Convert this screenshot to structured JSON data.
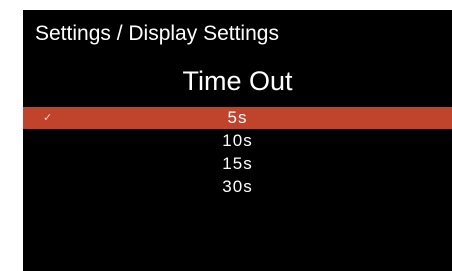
{
  "header": {
    "breadcrumb": "Settings / Display Settings"
  },
  "main": {
    "title": "Time Out",
    "selected_index": 0,
    "options": [
      {
        "label": "5s"
      },
      {
        "label": "10s"
      },
      {
        "label": "15s"
      },
      {
        "label": "30s"
      }
    ]
  },
  "colors": {
    "background": "#000000",
    "selection": "#c0442c",
    "text": "#ffffff"
  },
  "icons": {
    "selected_marker": "check-icon"
  }
}
